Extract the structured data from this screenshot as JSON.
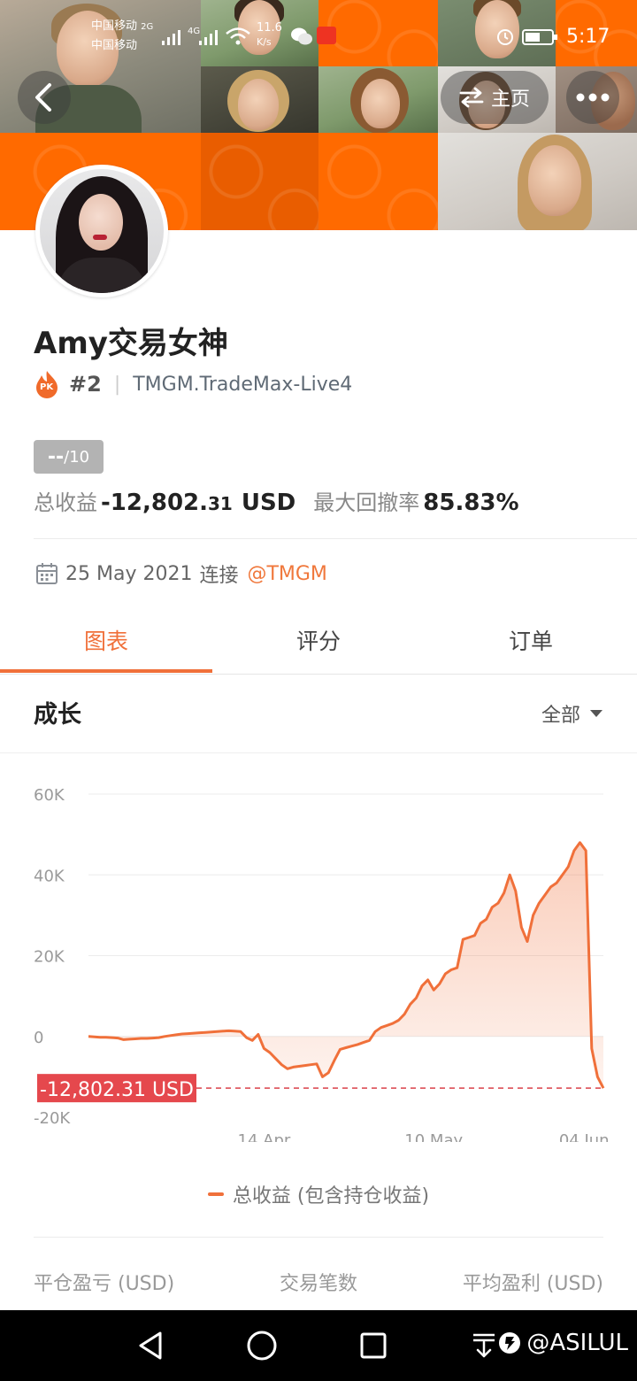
{
  "status_bar": {
    "carrier_1": "中国移动",
    "carrier_1_net": "2G",
    "carrier_2": "中国移动",
    "carrier_2_net": "4G",
    "speed_value": "11.6",
    "speed_unit": "K/s",
    "time": "5:17"
  },
  "header": {
    "home_label": "主页"
  },
  "profile": {
    "name": "Amy交易女神",
    "badge_text": "PK",
    "rank": "#2",
    "rank_separator": "|",
    "server": "TMGM.TradeMax-Live4",
    "score_value": "--",
    "score_max": "/10",
    "total_profit_label": "总收益",
    "total_profit_main": "-12,802.",
    "total_profit_cents": "31",
    "total_profit_unit": "USD",
    "max_drawdown_label": "最大回撤率",
    "max_drawdown_value": "85.83%",
    "connect_date": "25 May 2021",
    "connect_text": "连接",
    "broker_handle": "@TMGM"
  },
  "tabs": [
    {
      "label": "图表",
      "active": true
    },
    {
      "label": "评分",
      "active": false
    },
    {
      "label": "订单",
      "active": false
    }
  ],
  "growth": {
    "title": "成长",
    "range_label": "全部"
  },
  "chart_data": {
    "type": "area",
    "ylim": [
      -20000,
      60000
    ],
    "yticks": [
      60000,
      40000,
      20000,
      0,
      -20000
    ],
    "ytick_labels": [
      "60K",
      "40K",
      "20K",
      "0",
      "-20K"
    ],
    "x_tick_labels": [
      "14 Apr",
      "10 May",
      "04 Jun"
    ],
    "x_tick_index": [
      30,
      59,
      89
    ],
    "current_value_label": "-12,802.31 USD",
    "current_value": -12802.31,
    "legend": "总收益 (包含持仓收益)",
    "series": [
      {
        "name": "总收益 (包含持仓收益)",
        "color": "#f0703a",
        "values": [
          0,
          -100,
          -200,
          -200,
          -300,
          -400,
          -800,
          -700,
          -600,
          -500,
          -500,
          -400,
          -300,
          0,
          200,
          400,
          600,
          700,
          800,
          900,
          1000,
          1100,
          1200,
          1300,
          1400,
          1300,
          1200,
          -300,
          -1000,
          500,
          -3000,
          -4000,
          -5500,
          -7000,
          -8000,
          -7600,
          -7400,
          -7200,
          -7000,
          -6800,
          -10000,
          -9000,
          -6000,
          -3200,
          -2800,
          -2400,
          -2000,
          -1500,
          -1000,
          1200,
          2200,
          2700,
          3200,
          4000,
          5500,
          8000,
          9500,
          12500,
          14000,
          11500,
          13000,
          15500,
          16500,
          17000,
          24000,
          24500,
          25000,
          28000,
          29000,
          32000,
          33000,
          35500,
          40000,
          36000,
          27000,
          23500,
          30000,
          33000,
          35000,
          37000,
          38000,
          40000,
          42000,
          46000,
          48000,
          46000,
          -3000,
          -10000,
          -12802.31
        ]
      }
    ]
  },
  "bottom_stats": {
    "closed_pnl_label": "平仓盈亏 (USD)",
    "trade_count_label": "交易笔数",
    "avg_profit_label": "平均盈利 (USD)"
  },
  "watermark": "@ASILUL",
  "icons": {
    "back": "chevron-left-icon",
    "switch": "switch-arrows-icon",
    "more": "more-dots-icon",
    "calendar": "calendar-icon",
    "dropdown": "triangle-down-icon",
    "flame": "pk-flame-icon"
  }
}
